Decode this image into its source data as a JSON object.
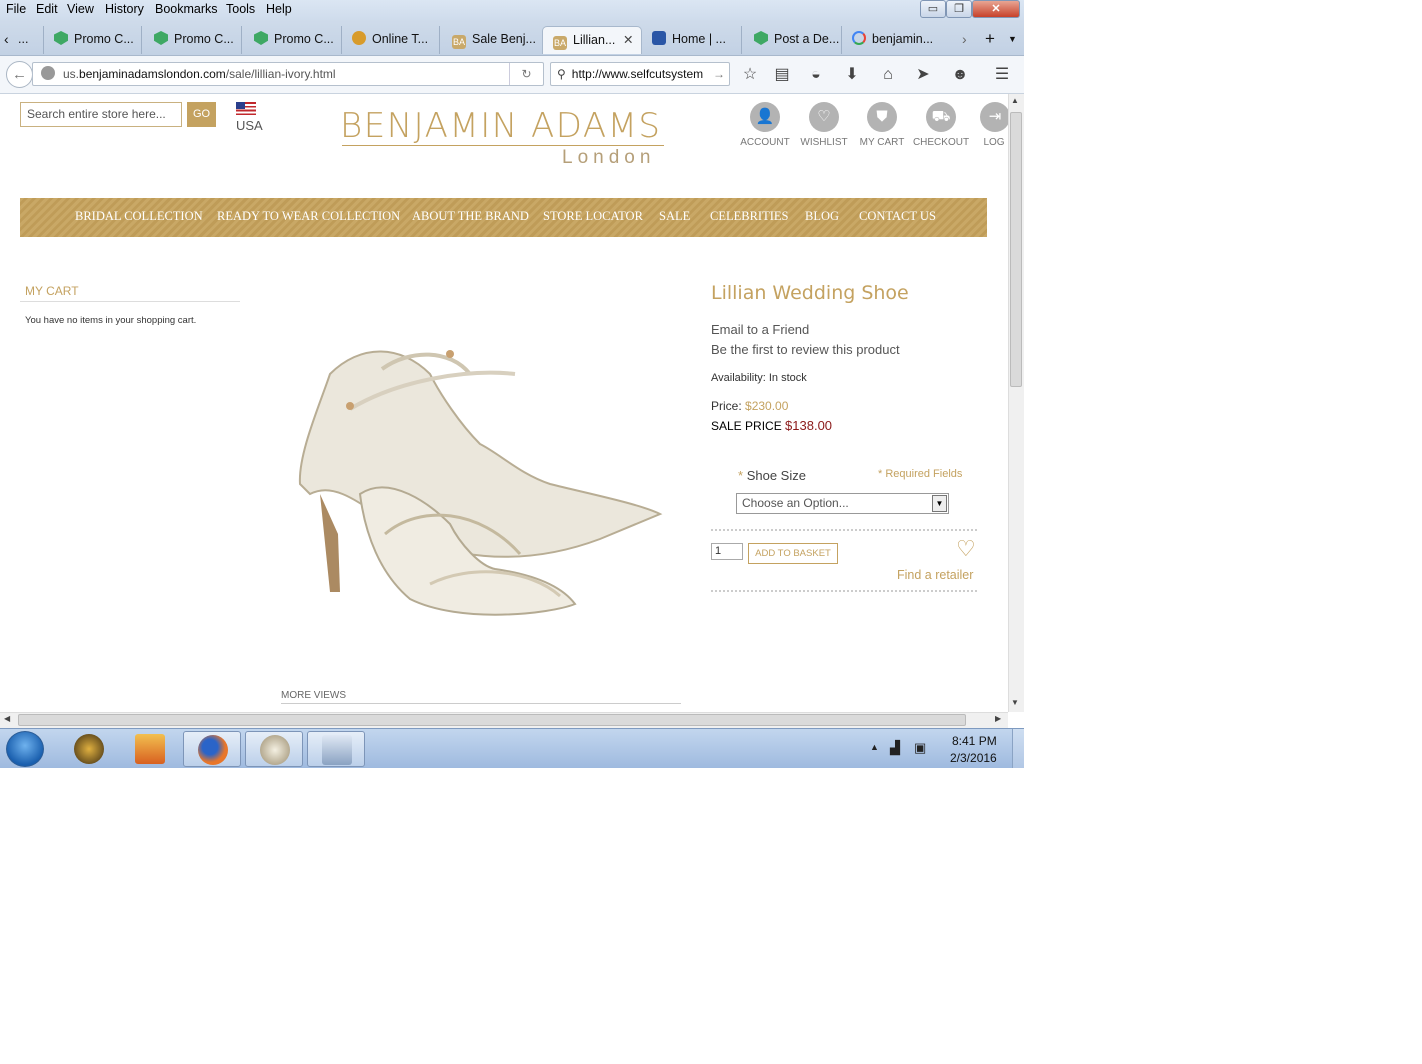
{
  "menu": [
    "File",
    "Edit",
    "View",
    "History",
    "Bookmarks",
    "Tools",
    "Help"
  ],
  "window_buttons": {
    "minimize": "▭",
    "maximize": "❐",
    "close": "✕"
  },
  "tabs": [
    {
      "label": "Promo C...",
      "icon": "green-shield"
    },
    {
      "label": "Promo C...",
      "icon": "green-shield"
    },
    {
      "label": "Promo C...",
      "icon": "green-shield"
    },
    {
      "label": "Online T...",
      "icon": "online-tools"
    },
    {
      "label": "Sale Benj...",
      "icon": "BA"
    },
    {
      "label": "Lillian...",
      "icon": "BA",
      "active": true
    },
    {
      "label": "Home | ...",
      "icon": "home-site"
    },
    {
      "label": "Post a De...",
      "icon": "green-shield"
    },
    {
      "label": "benjamin...",
      "icon": "google"
    }
  ],
  "tab_ellipsis": "...",
  "url": {
    "prefix": "us.",
    "host": "benjaminadamslondon.com",
    "path": "/sale/lillian-ivory.html"
  },
  "search_engine_value": "http://www.selfcutsystem",
  "store": {
    "search_placeholder": "Search entire store here...",
    "go_label": "GO",
    "country": "USA",
    "logo_main": "BENJAMIN ADAMS",
    "logo_sub": "London",
    "account_links": [
      "ACCOUNT",
      "WISHLIST",
      "MY CART",
      "CHECKOUT",
      "LOG"
    ],
    "nav": [
      "BRIDAL COLLECTION",
      "READY TO WEAR COLLECTION",
      "ABOUT THE BRAND",
      "STORE LOCATOR",
      "SALE",
      "CELEBRITIES",
      "BLOG",
      "CONTACT US"
    ]
  },
  "sidebar": {
    "title": "MY CART",
    "empty_text": "You have no items in your shopping cart."
  },
  "product": {
    "name": "Lillian Wedding Shoe",
    "email_friend": "Email to a Friend",
    "first_review": "Be the first to review this product",
    "availability": "Availability: In stock",
    "price_label": "Price:",
    "price_value": "$230.00",
    "sale_label": "SALE PRICE",
    "sale_value": "$138.00",
    "size_label": "Shoe Size",
    "required_fields": "Required Fields",
    "required_mark": "*",
    "size_option": "Choose an Option...",
    "qty": "1",
    "add_to_basket": "ADD TO BASKET",
    "find_retailer": "Find a retailer",
    "more_views": "MORE VIEWS"
  },
  "clock": {
    "time": "8:41 PM",
    "date": "2/3/2016"
  },
  "colors": {
    "brand_gold": "#c4a260",
    "sale_red": "#8b1a1a"
  }
}
